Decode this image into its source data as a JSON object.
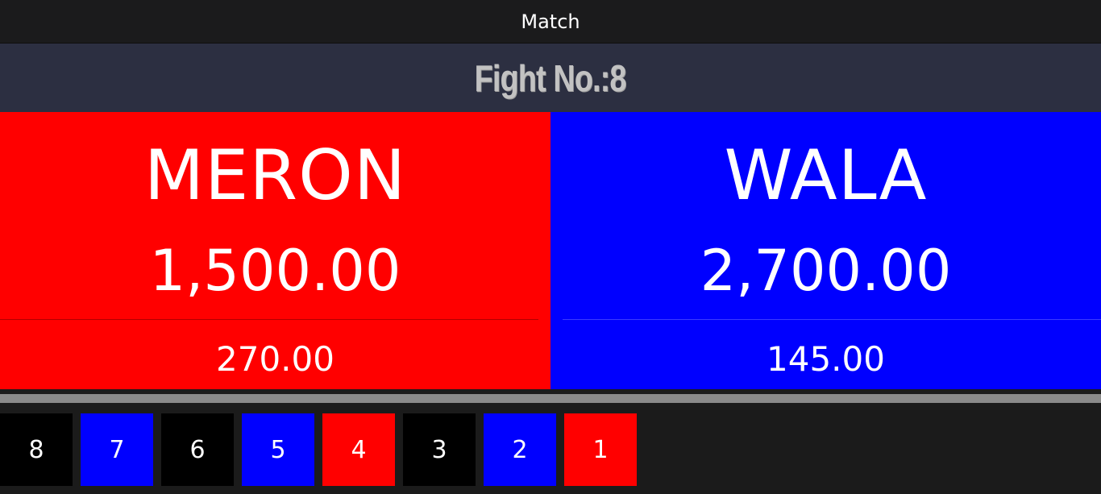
{
  "window": {
    "title": "Match"
  },
  "fight": {
    "label": "Fight No.:8"
  },
  "meron": {
    "name": "MERON",
    "amount": "1,500.00",
    "payout": "270.00",
    "color": "#ff0000"
  },
  "wala": {
    "name": "WALA",
    "amount": "2,700.00",
    "payout": "145.00",
    "color": "#0000ff"
  },
  "history": [
    {
      "number": "8",
      "color": "#000000"
    },
    {
      "number": "7",
      "color": "#0000ff"
    },
    {
      "number": "6",
      "color": "#000000"
    },
    {
      "number": "5",
      "color": "#0000ff"
    },
    {
      "number": "4",
      "color": "#ff0000"
    },
    {
      "number": "3",
      "color": "#000000"
    },
    {
      "number": "2",
      "color": "#0000ff"
    },
    {
      "number": "1",
      "color": "#ff0000"
    }
  ]
}
